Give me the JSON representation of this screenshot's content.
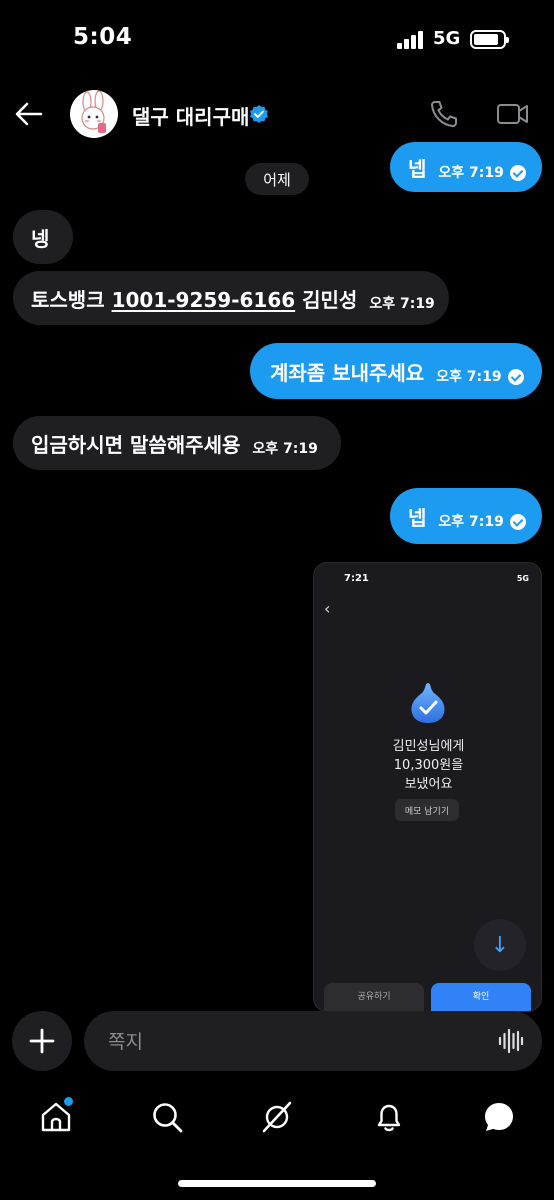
{
  "status_bar": {
    "time": "5:04",
    "network": "5G"
  },
  "header": {
    "contact_name": "댈구 대리구매"
  },
  "date_separator": "어제",
  "messages": [
    {
      "text": "넵",
      "time": "오후 7:19",
      "direction": "out"
    },
    {
      "text": "넹",
      "time": "",
      "direction": "in"
    },
    {
      "text_prefix": "토스뱅크 ",
      "account": "1001-9259-6166",
      "text_suffix": " 김민성",
      "time": "오후 7:19",
      "direction": "in"
    },
    {
      "text": "계좌좀 보내주세요",
      "time": "오후 7:19",
      "direction": "out"
    },
    {
      "text": "입금하시면 말씀해주세용",
      "time": "오후 7:19",
      "direction": "in"
    },
    {
      "text": "넵",
      "time": "오후 7:19",
      "direction": "out"
    }
  ],
  "image_message": {
    "time": "7:21",
    "network": "5G",
    "line1": "김민성님에게",
    "line2": "10,300원을",
    "line3": "보냈어요",
    "memo_button": "메모 남기기",
    "left_button": "공유하기",
    "right_button": "확인"
  },
  "composer": {
    "placeholder": "쪽지"
  },
  "colors": {
    "accent": "#1d9bf0",
    "incoming_bubble": "#1f1f22",
    "background": "#000000"
  },
  "nav": [
    "home-icon",
    "search-icon",
    "grok-icon",
    "bell-icon",
    "messages-icon"
  ]
}
